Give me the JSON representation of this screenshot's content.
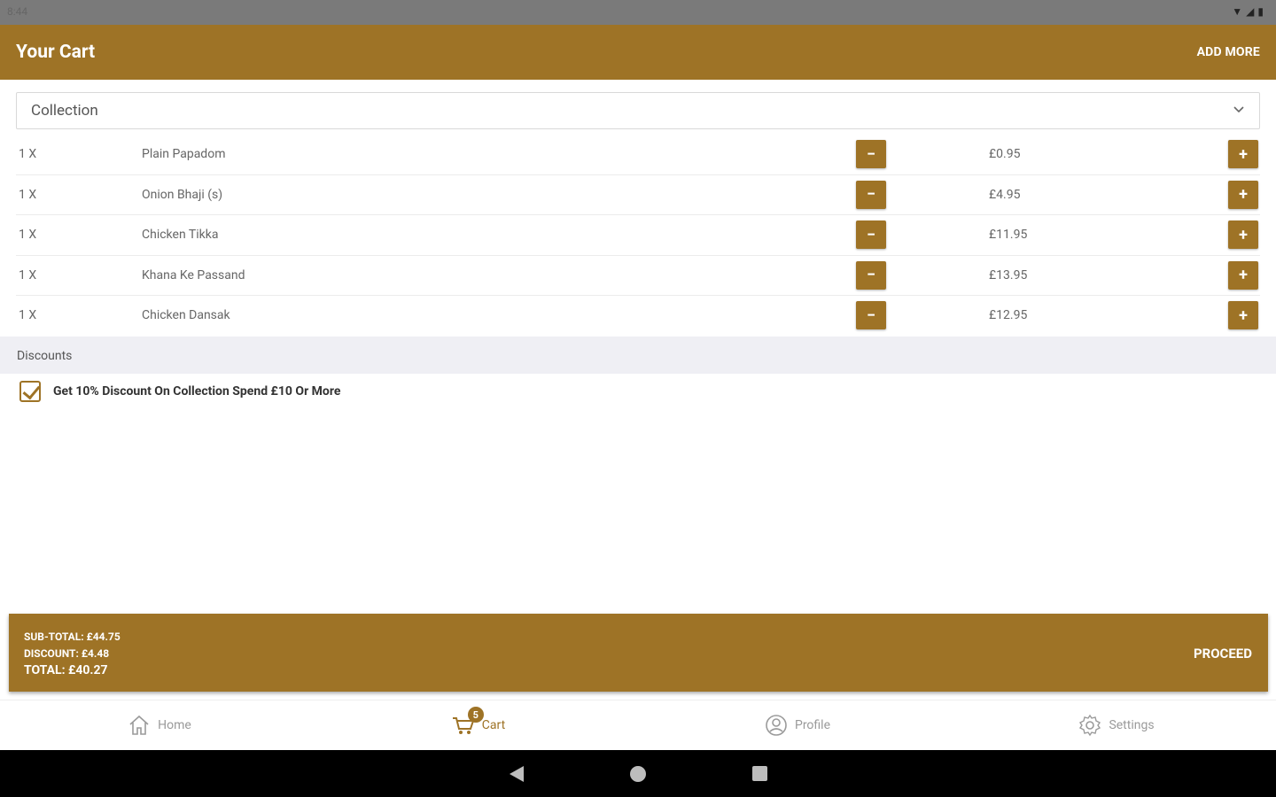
{
  "status_bar": {
    "time": "8:44",
    "icons": [
      "wifi-icon",
      "signal-icon",
      "battery-icon"
    ]
  },
  "app_bar": {
    "title": "Your Cart",
    "add_more_label": "ADD MORE"
  },
  "order_type": {
    "selected": "Collection"
  },
  "items": [
    {
      "qty": "1 X",
      "name": "Plain Papadom",
      "price": "£0.95"
    },
    {
      "qty": "1 X",
      "name": "Onion Bhaji (s)",
      "price": "£4.95"
    },
    {
      "qty": "1 X",
      "name": "Chicken Tikka",
      "price": "£11.95"
    },
    {
      "qty": "1 X",
      "name": "Khana Ke Passand",
      "price": "£13.95"
    },
    {
      "qty": "1 X",
      "name": "Chicken Dansak",
      "price": "£12.95"
    }
  ],
  "discounts": {
    "header": "Discounts",
    "items": [
      {
        "label": "Get 10% Discount On Collection Spend £10 Or More",
        "checked": true
      }
    ]
  },
  "summary": {
    "subtotal": "SUB-TOTAL: £44.75",
    "discount": "DISCOUNT: £4.48",
    "total": "TOTAL: £40.27",
    "proceed_label": "PROCEED"
  },
  "bottom_nav": {
    "items": [
      {
        "label": "Home",
        "icon": "home-icon"
      },
      {
        "label": "Cart",
        "icon": "cart-icon",
        "badge": "5"
      },
      {
        "label": "Profile",
        "icon": "profile-icon"
      },
      {
        "label": "Settings",
        "icon": "settings-icon"
      }
    ]
  },
  "colors": {
    "accent": "#9e7326",
    "discount_header_bg": "#efeff4"
  }
}
